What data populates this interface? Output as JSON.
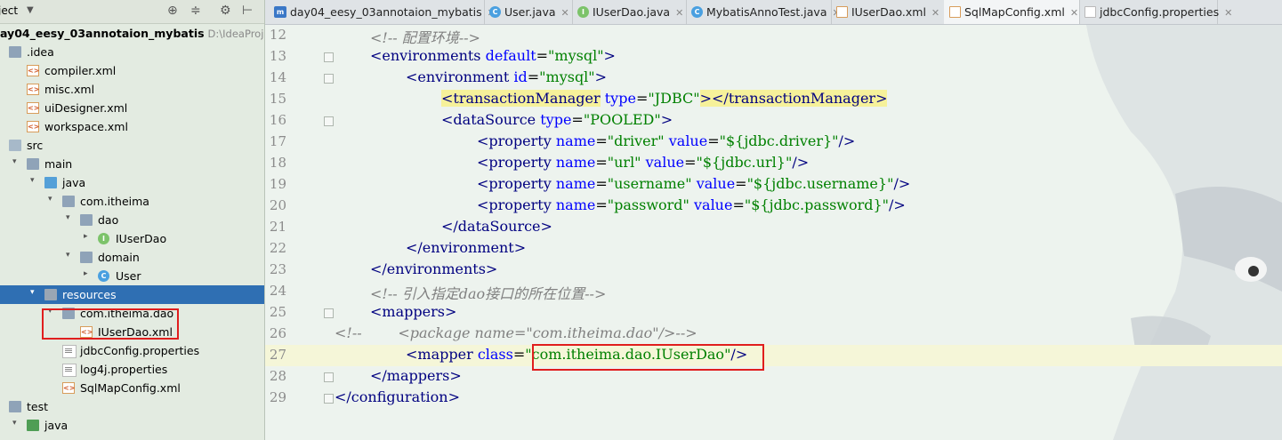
{
  "project": {
    "title": "ject",
    "tree": [
      {
        "label": "ay04_eesy_03annotaion_mybatis",
        "path": "D:\\IdeaProjects\\",
        "icon": "none",
        "indent": 0,
        "arrow": "",
        "bold": true
      },
      {
        "label": ".idea",
        "icon": "folder",
        "indent": 0,
        "arrow": ""
      },
      {
        "label": "compiler.xml",
        "icon": "xml",
        "indent": 1,
        "arrow": ""
      },
      {
        "label": "misc.xml",
        "icon": "xml",
        "indent": 1,
        "arrow": ""
      },
      {
        "label": "uiDesigner.xml",
        "icon": "xml",
        "indent": 1,
        "arrow": ""
      },
      {
        "label": "workspace.xml",
        "icon": "xml",
        "indent": 1,
        "arrow": ""
      },
      {
        "label": "src",
        "icon": "folder-src",
        "indent": 0,
        "arrow": ""
      },
      {
        "label": "main",
        "icon": "folder",
        "indent": 1,
        "arrow": "down"
      },
      {
        "label": "java",
        "icon": "folder-java",
        "indent": 2,
        "arrow": "down"
      },
      {
        "label": "com.itheima",
        "icon": "folder",
        "indent": 3,
        "arrow": "down"
      },
      {
        "label": "dao",
        "icon": "folder",
        "indent": 4,
        "arrow": "down"
      },
      {
        "label": "IUserDao",
        "icon": "interface",
        "indent": 5,
        "arrow": "right"
      },
      {
        "label": "domain",
        "icon": "folder",
        "indent": 4,
        "arrow": "down"
      },
      {
        "label": "User",
        "icon": "class",
        "indent": 5,
        "arrow": "right"
      },
      {
        "label": "resources",
        "icon": "folder-res",
        "indent": 2,
        "arrow": "down",
        "selected": true
      },
      {
        "label": "com.itheima.dao",
        "icon": "folder",
        "indent": 3,
        "arrow": "down"
      },
      {
        "label": "IUserDao.xml",
        "icon": "xml",
        "indent": 4,
        "arrow": ""
      },
      {
        "label": "jdbcConfig.properties",
        "icon": "props",
        "indent": 3,
        "arrow": ""
      },
      {
        "label": "log4j.properties",
        "icon": "props",
        "indent": 3,
        "arrow": ""
      },
      {
        "label": "SqlMapConfig.xml",
        "icon": "xml",
        "indent": 3,
        "arrow": ""
      },
      {
        "label": "test",
        "icon": "folder",
        "indent": 0,
        "arrow": "down"
      },
      {
        "label": "java",
        "icon": "folder-test",
        "indent": 1,
        "arrow": "down"
      }
    ]
  },
  "tabs": [
    {
      "label": "day04_eesy_03annotaion_mybatis",
      "icon": "m",
      "active": false
    },
    {
      "label": "User.java",
      "icon": "c",
      "active": false
    },
    {
      "label": "IUserDao.java",
      "icon": "i",
      "active": false
    },
    {
      "label": "MybatisAnnoTest.java",
      "icon": "c",
      "active": false
    },
    {
      "label": "IUserDao.xml",
      "icon": "x",
      "active": false
    },
    {
      "label": "SqlMapConfig.xml",
      "icon": "x",
      "active": true
    },
    {
      "label": "jdbcConfig.properties",
      "icon": "p",
      "active": false
    }
  ],
  "editor": {
    "current_line": "27",
    "lines": [
      {
        "n": "12",
        "indent": 1,
        "tokens": [
          [
            "cmt",
            "<!-- 配置环境-->"
          ]
        ]
      },
      {
        "n": "13",
        "indent": 1,
        "tokens": [
          [
            "tag",
            "<"
          ],
          [
            "tagname",
            "environments"
          ],
          [
            "sp",
            " "
          ],
          [
            "attr",
            "default"
          ],
          [
            "br",
            "="
          ],
          [
            "val",
            "\"mysql\""
          ],
          [
            "tag",
            ">"
          ]
        ]
      },
      {
        "n": "14",
        "indent": 2,
        "tokens": [
          [
            "tag",
            "<"
          ],
          [
            "tagname",
            "environment"
          ],
          [
            "sp",
            " "
          ],
          [
            "attr",
            "id"
          ],
          [
            "br",
            "="
          ],
          [
            "val",
            "\"mysql\""
          ],
          [
            "tag",
            ">"
          ]
        ]
      },
      {
        "n": "15",
        "indent": 3,
        "tokens": [
          [
            "tag hl",
            "<"
          ],
          [
            "tagname hl",
            "transactionManager"
          ],
          [
            "sp",
            " "
          ],
          [
            "attr",
            "type"
          ],
          [
            "br",
            "="
          ],
          [
            "val",
            "\"JDBC\""
          ],
          [
            "tag hl",
            ">"
          ],
          [
            "tag hl",
            "</"
          ],
          [
            "tagname hl",
            "transactionManager"
          ],
          [
            "tag hl",
            ">"
          ]
        ]
      },
      {
        "n": "16",
        "indent": 3,
        "tokens": [
          [
            "tag",
            "<"
          ],
          [
            "tagname",
            "dataSource"
          ],
          [
            "sp",
            " "
          ],
          [
            "attr",
            "type"
          ],
          [
            "br",
            "="
          ],
          [
            "val",
            "\"POOLED\""
          ],
          [
            "tag",
            ">"
          ]
        ]
      },
      {
        "n": "17",
        "indent": 4,
        "tokens": [
          [
            "tag",
            "<"
          ],
          [
            "tagname",
            "property"
          ],
          [
            "sp",
            " "
          ],
          [
            "attr",
            "name"
          ],
          [
            "br",
            "="
          ],
          [
            "val",
            "\"driver\""
          ],
          [
            "sp",
            " "
          ],
          [
            "attr",
            "value"
          ],
          [
            "br",
            "="
          ],
          [
            "val",
            "\"${jdbc.driver}\""
          ],
          [
            "tag",
            "/>"
          ]
        ]
      },
      {
        "n": "18",
        "indent": 4,
        "tokens": [
          [
            "tag",
            "<"
          ],
          [
            "tagname",
            "property"
          ],
          [
            "sp",
            " "
          ],
          [
            "attr",
            "name"
          ],
          [
            "br",
            "="
          ],
          [
            "val",
            "\"url\""
          ],
          [
            "sp",
            " "
          ],
          [
            "attr",
            "value"
          ],
          [
            "br",
            "="
          ],
          [
            "val",
            "\"${jdbc.url}\""
          ],
          [
            "tag",
            "/>"
          ]
        ]
      },
      {
        "n": "19",
        "indent": 4,
        "tokens": [
          [
            "tag",
            "<"
          ],
          [
            "tagname",
            "property"
          ],
          [
            "sp",
            " "
          ],
          [
            "attr",
            "name"
          ],
          [
            "br",
            "="
          ],
          [
            "val",
            "\"username\""
          ],
          [
            "sp",
            " "
          ],
          [
            "attr",
            "value"
          ],
          [
            "br",
            "="
          ],
          [
            "val",
            "\"${jdbc.username}\""
          ],
          [
            "tag",
            "/>"
          ]
        ]
      },
      {
        "n": "20",
        "indent": 4,
        "tokens": [
          [
            "tag",
            "<"
          ],
          [
            "tagname",
            "property"
          ],
          [
            "sp",
            " "
          ],
          [
            "attr",
            "name"
          ],
          [
            "br",
            "="
          ],
          [
            "val",
            "\"password\""
          ],
          [
            "sp",
            " "
          ],
          [
            "attr",
            "value"
          ],
          [
            "br",
            "="
          ],
          [
            "val",
            "\"${jdbc.password}\""
          ],
          [
            "tag",
            "/>"
          ]
        ]
      },
      {
        "n": "21",
        "indent": 3,
        "tokens": [
          [
            "tag",
            "</"
          ],
          [
            "tagname",
            "dataSource"
          ],
          [
            "tag",
            ">"
          ]
        ]
      },
      {
        "n": "22",
        "indent": 2,
        "tokens": [
          [
            "tag",
            "</"
          ],
          [
            "tagname",
            "environment"
          ],
          [
            "tag",
            ">"
          ]
        ]
      },
      {
        "n": "23",
        "indent": 1,
        "tokens": [
          [
            "tag",
            "</"
          ],
          [
            "tagname",
            "environments"
          ],
          [
            "tag",
            ">"
          ]
        ]
      },
      {
        "n": "24",
        "indent": 1,
        "tokens": [
          [
            "cmt",
            "<!-- 引入指定dao接口的所在位置-->"
          ]
        ]
      },
      {
        "n": "25",
        "indent": 1,
        "tokens": [
          [
            "tag",
            "<"
          ],
          [
            "tagname",
            "mappers"
          ],
          [
            "tag",
            ">"
          ]
        ]
      },
      {
        "n": "26",
        "indent": 0,
        "tokens": [
          [
            "cmt",
            "<!--        <package name=\"com.itheima.dao\"/>-->"
          ]
        ]
      },
      {
        "n": "27",
        "indent": 2,
        "tokens": [
          [
            "tag",
            "<"
          ],
          [
            "tagname",
            "mapper"
          ],
          [
            "sp",
            " "
          ],
          [
            "attr",
            "class"
          ],
          [
            "br",
            "="
          ],
          [
            "val",
            "\"com.itheima.dao.IUserDao\""
          ],
          [
            "tag",
            "/>"
          ]
        ]
      },
      {
        "n": "28",
        "indent": 1,
        "tokens": [
          [
            "tag",
            "</"
          ],
          [
            "tagname",
            "mappers"
          ],
          [
            "tag",
            ">"
          ]
        ]
      },
      {
        "n": "29",
        "indent": 0,
        "tokens": [
          [
            "tag",
            "</"
          ],
          [
            "tagname",
            "configuration"
          ],
          [
            "tag",
            ">"
          ]
        ]
      }
    ]
  },
  "colors": {
    "selection": "#2f6fb3",
    "annotation_box": "#e01e1e",
    "xml_tag": "#000080",
    "xml_attr": "#0000ff",
    "xml_value": "#008000",
    "comment": "#808080"
  }
}
